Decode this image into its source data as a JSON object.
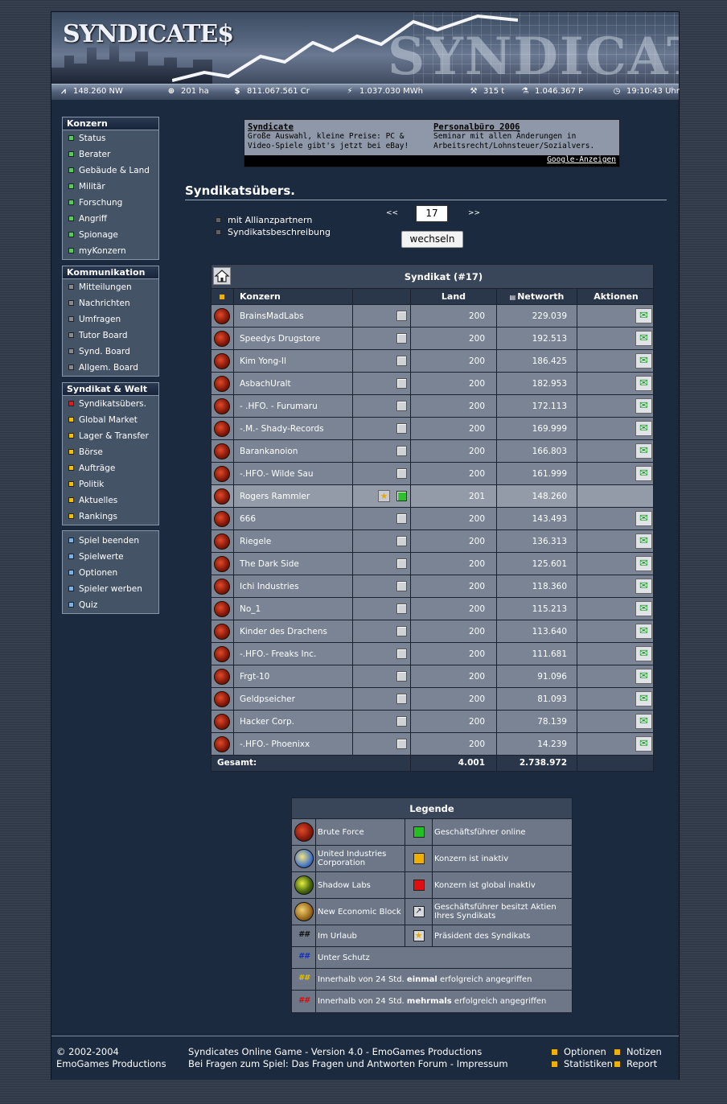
{
  "banner": {
    "logo": "SYNDICATE$"
  },
  "stats": [
    {
      "icon": "networth-graph-icon",
      "glyph": "⩘",
      "value": "148.260 NW"
    },
    {
      "icon": "globe-icon",
      "glyph": "⊕",
      "value": "201 ha"
    },
    {
      "icon": "dollar-icon",
      "glyph": "$",
      "value": "811.067.561 Cr"
    },
    {
      "icon": "energy-icon",
      "glyph": "⚡",
      "value": "1.037.030 MWh"
    },
    {
      "icon": "ore-tools-icon",
      "glyph": "⚒",
      "value": "315 t"
    },
    {
      "icon": "research-icon",
      "glyph": "⚗",
      "value": "1.046.367 P"
    },
    {
      "icon": "clock-icon",
      "glyph": "◷",
      "value": "19:10:43 Uhr"
    }
  ],
  "menus": {
    "konzern": {
      "title": "Konzern",
      "items": [
        "Status",
        "Berater",
        "Gebäude & Land",
        "Militär",
        "Forschung",
        "Angriff",
        "Spionage",
        "myKonzern"
      ]
    },
    "kommunikation": {
      "title": "Kommunikation",
      "items": [
        "Mitteilungen",
        "Nachrichten",
        "Umfragen",
        "Tutor Board",
        "Synd. Board",
        "Allgem. Board"
      ]
    },
    "syndikat": {
      "title": "Syndikat & Welt",
      "items": [
        "Syndikatsübers.",
        "Global Market",
        "Lager & Transfer",
        "Börse",
        "Aufträge",
        "Politik",
        "Aktuelles",
        "Rankings"
      ]
    },
    "misc": {
      "items": [
        "Spiel beenden",
        "Spielwerte",
        "Optionen",
        "Spieler werben",
        "Quiz"
      ]
    }
  },
  "colors": {
    "menu_green": "#5ac85a",
    "menu_red": "#d42020",
    "menu_yellow": "#f0c000",
    "menu_blue": "#7eb0e0",
    "menu_gray": "#8a8a8a"
  },
  "ad": {
    "left_title": "Syndicate",
    "left_text": "Große Auswahl, kleine Preise: PC & Video-Spiele gibt's jetzt bei eBay!",
    "right_title": "Personalbüro 2006",
    "right_text": "Seminar mit allen Änderungen in Arbeitsrecht/Lohnsteuer/Sozialvers.",
    "footer": "Google-Anzeigen"
  },
  "page": {
    "title": "Syndikatsübers.",
    "option_allies": "mit Allianzpartnern",
    "option_description": "Syndikatsbeschreibung",
    "nav_prev": "<<",
    "nav_next": ">>",
    "syndicate_number": "17",
    "switch_button": "wechseln"
  },
  "table": {
    "title": "Syndikat (#17)",
    "headers": {
      "konzern": "Konzern",
      "land": "Land",
      "networth": "Networth",
      "aktionen": "Aktionen"
    },
    "rows": [
      {
        "name": "BrainsMadLabs",
        "land": "200",
        "nw": "229.039"
      },
      {
        "name": "Speedys Drugstore",
        "land": "200",
        "nw": "192.513"
      },
      {
        "name": "Kim Yong-Il",
        "land": "200",
        "nw": "186.425"
      },
      {
        "name": "AsbachUralt",
        "land": "200",
        "nw": "182.953"
      },
      {
        "name": "- .HFO. - Furumaru",
        "land": "200",
        "nw": "172.113"
      },
      {
        "name": "-.M.- Shady-Records",
        "land": "200",
        "nw": "169.999"
      },
      {
        "name": "Barankanoion",
        "land": "200",
        "nw": "166.803"
      },
      {
        "name": "-.HFO.- Wilde Sau",
        "land": "200",
        "nw": "161.999"
      },
      {
        "name": "Rogers Rammler",
        "land": "201",
        "nw": "148.260",
        "self": true
      },
      {
        "name": "666",
        "land": "200",
        "nw": "143.493"
      },
      {
        "name": "Riegele",
        "land": "200",
        "nw": "136.313"
      },
      {
        "name": "The Dark Side",
        "land": "200",
        "nw": "125.601"
      },
      {
        "name": "Ichi Industries",
        "land": "200",
        "nw": "118.360"
      },
      {
        "name": "No_1",
        "land": "200",
        "nw": "115.213"
      },
      {
        "name": "Kinder des Drachens",
        "land": "200",
        "nw": "113.640"
      },
      {
        "name": "-.HFO.- Freaks Inc.",
        "land": "200",
        "nw": "111.681"
      },
      {
        "name": "Frgt-10",
        "land": "200",
        "nw": "91.096"
      },
      {
        "name": "Geldpseicher",
        "land": "200",
        "nw": "81.093"
      },
      {
        "name": "Hacker Corp.",
        "land": "200",
        "nw": "78.139"
      },
      {
        "name": "-.HFO.- Phoenixx",
        "land": "200",
        "nw": "14.239"
      }
    ],
    "total": {
      "label": "Gesamt:",
      "land": "4.001",
      "nw": "2.738.972"
    }
  },
  "legend": {
    "title": "Legende",
    "pairs": [
      {
        "icon": "brute-force-icon",
        "label": "Brute Force",
        "icon2": "green-square-icon",
        "color2": "#22c022",
        "label2": "Geschäftsführer online"
      },
      {
        "icon": "united-industries-icon",
        "label": "United Industries Corporation",
        "icon2": "yellow-square-icon",
        "color2": "#f0b000",
        "label2": "Konzern ist inaktiv"
      },
      {
        "icon": "shadow-labs-icon",
        "label": "Shadow Labs",
        "icon2": "red-square-icon",
        "color2": "#e01010",
        "label2": "Konzern ist global inaktiv"
      },
      {
        "icon": "new-economic-block-icon",
        "label": "New Economic Block",
        "icon2": "stock-chart-icon",
        "color2": "#d8dce0",
        "label2": "Geschäftsführer besitzt Aktien Ihres Syndikats"
      },
      {
        "icon": "vacation-hash-icon",
        "label": "Im Urlaub",
        "icon2": "president-star-icon",
        "color2": "#d8dce0",
        "label2": "Präsident des Syndikats"
      }
    ],
    "hash_rows": [
      {
        "hash": "##",
        "color": "#1a1a1a",
        "text": "Unter Schutz",
        "bold": "",
        "after": ""
      },
      {
        "hash": "##",
        "color": "#1530c0",
        "text": "Unter Schutz",
        "bold": "",
        "after": ""
      },
      {
        "hash": "##",
        "color": "#e0c000",
        "text": "Innerhalb von 24 Std.",
        "bold": "einmal",
        "after": "erfolgreich angegriffen"
      },
      {
        "hash": "##",
        "color": "#d01010",
        "text": "Innerhalb von 24 Std.",
        "bold": "mehrmals",
        "after": "erfolgreich angegriffen"
      }
    ]
  },
  "footer": {
    "copyright": "© 2002-2004",
    "company": "EmoGames Productions",
    "version": "Syndicates Online Game - Version 4.0 - EmoGames Productions",
    "faq": "Bei Fragen zum Spiel: Das Fragen und Antworten Forum - Impressum",
    "links": [
      "Optionen",
      "Notizen",
      "Statistiken",
      "Report"
    ]
  }
}
